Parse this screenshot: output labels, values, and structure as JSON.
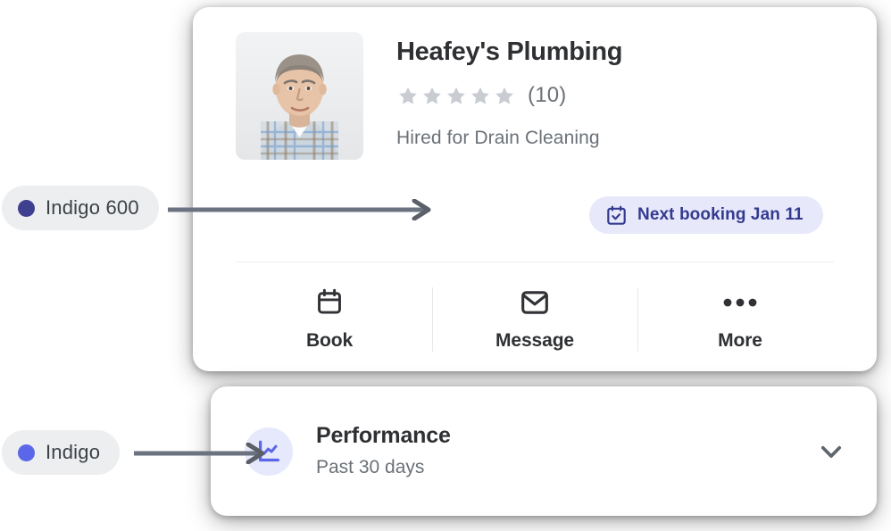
{
  "provider": {
    "name": "Heafey's Plumbing",
    "avatar_alt": "provider-headshot",
    "rating_stars": 5,
    "review_count": "(10)",
    "hired_for": "Hired for Drain Cleaning",
    "booking_badge": {
      "label": "Next booking Jan 11",
      "icon": "calendar-check-icon",
      "background": "#e7e9fb",
      "text_color": "#343a8f"
    }
  },
  "actions": [
    {
      "label": "Book",
      "icon": "calendar-icon"
    },
    {
      "label": "Message",
      "icon": "envelope-icon"
    },
    {
      "label": "More",
      "icon": "ellipsis-icon"
    }
  ],
  "performance": {
    "title": "Performance",
    "subtitle": "Past 30 days",
    "icon": "chart-line-icon",
    "icon_background": "#e6e9fc",
    "icon_color": "#5a67e8",
    "expand_icon": "chevron-down-icon"
  },
  "annotations": [
    {
      "label": "Indigo 600",
      "dot_color": "#3f3f8f",
      "target": "booking-badge"
    },
    {
      "label": "Indigo",
      "dot_color": "#5a67e8",
      "target": "performance-icon"
    }
  ],
  "palette": {
    "card_background": "#ffffff",
    "page_background": "#ffffff",
    "pill_background": "#eceef0",
    "star_color": "#c9ccd1",
    "muted_text": "#6b7177",
    "heading_text": "#2f3033",
    "divider": "#eceef0"
  }
}
